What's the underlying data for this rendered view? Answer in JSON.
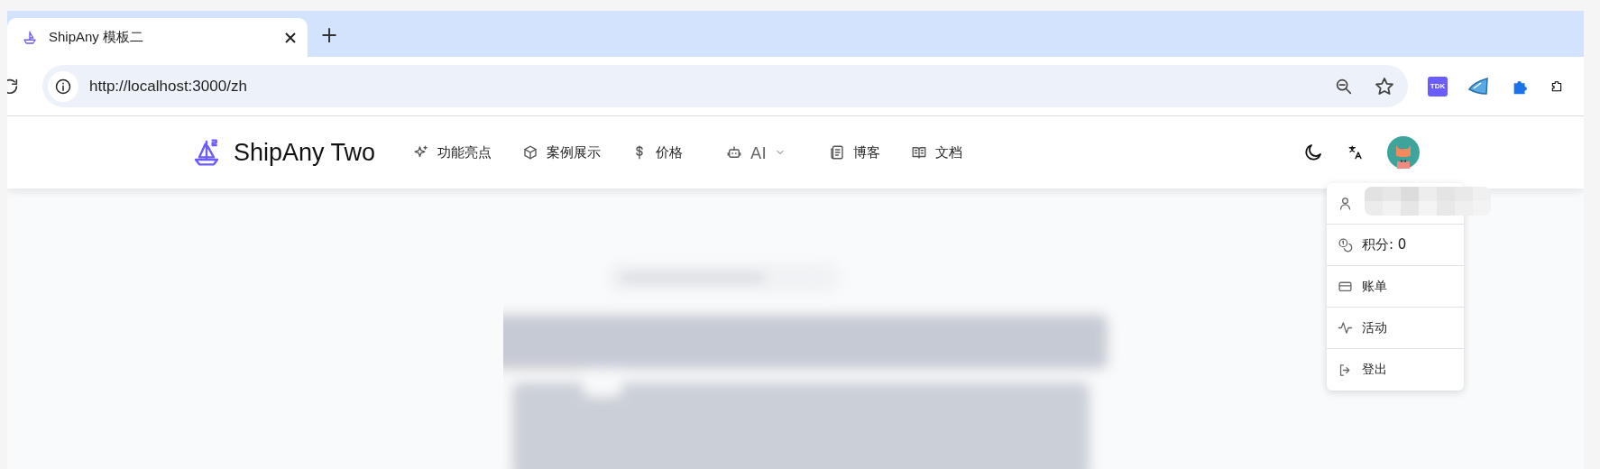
{
  "browser": {
    "tab": {
      "title": "ShipAny 模板二",
      "selected": true
    },
    "new_tab": "+",
    "extension_badge": "TDK",
    "url": "http://localhost:3000/zh"
  },
  "site": {
    "brand": "ShipAny Two",
    "nav": [
      {
        "label": "功能亮点",
        "has_menu": false
      },
      {
        "label": "案例展示",
        "has_menu": false
      },
      {
        "label": "价格",
        "has_menu": false
      },
      {
        "label": "AI",
        "has_menu": true
      },
      {
        "label": "博客",
        "has_menu": false
      },
      {
        "label": "文档",
        "has_menu": false
      }
    ]
  },
  "user_menu": {
    "open": true,
    "items": [
      {
        "kind": "redacted"
      },
      {
        "kind": "item",
        "label": "积分: 0"
      },
      {
        "kind": "item",
        "label": "账单"
      },
      {
        "kind": "item",
        "label": "活动"
      },
      {
        "kind": "item",
        "label": "登出"
      }
    ]
  }
}
